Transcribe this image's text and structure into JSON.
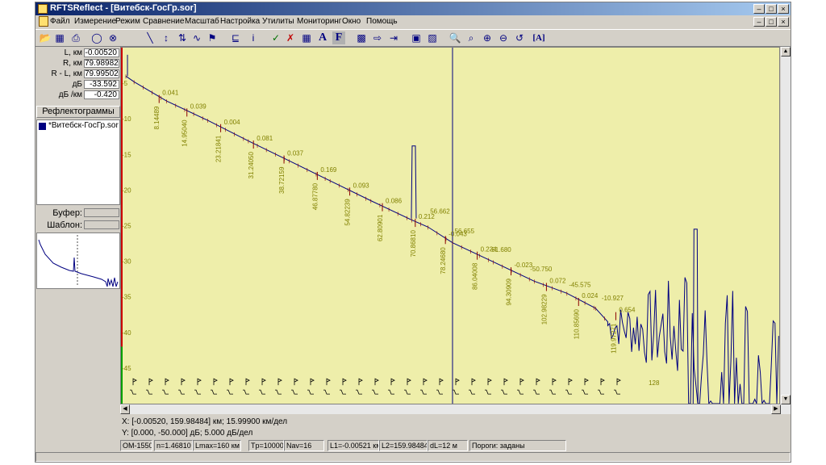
{
  "window": {
    "title": "RFTSReflect - [Витебск-ГосГр.sor]"
  },
  "menu": [
    "Файл",
    "Измерение",
    "Режим",
    "Сравнение",
    "Масштаб",
    "Настройка",
    "Утилиты",
    "Мониторинг",
    "Окно",
    "Помощь"
  ],
  "toolbar_icons": [
    "open-icon",
    "save-icon",
    "print-icon",
    "circle-icon",
    "circle-x-icon",
    "trace-icon",
    "trace-marks-icon",
    "split-marks-icon",
    "wave-icon",
    "flag-icon",
    "event-table-icon",
    "info-icon",
    "check-icon",
    "delete-marker-icon",
    "grid-icon",
    "font-a-icon",
    "font-f-icon",
    "chat-icon",
    "export-icon",
    "import-icon",
    "marker-add-icon",
    "marker-move-icon",
    "zoom-region-icon",
    "zoom-fit-icon",
    "zoom-in-icon",
    "zoom-out-icon",
    "refresh-icon",
    "text-a-icon"
  ],
  "params": [
    {
      "label": "L, км",
      "value": "-0.00520"
    },
    {
      "label": "R, км",
      "value": "79.98982"
    },
    {
      "label": "R - L, км",
      "value": "79.99502"
    },
    {
      "label": "дБ",
      "value": "-33.592"
    },
    {
      "label": "дБ /км",
      "value": "-0.420"
    }
  ],
  "reflectograms": {
    "title": "Рефлектограммы",
    "files": [
      "*Витебск-ГосГр.sor"
    ]
  },
  "buffer": {
    "label": "Буфер:",
    "value": ""
  },
  "template": {
    "label": "Шаблон:",
    "value": ""
  },
  "info": {
    "x_line": "X: [-0.00520, 159.98484] км; 15.99900 км/дел",
    "y_line": "Y: [0.000, -50.000] дБ; 5.000 дБ/дел"
  },
  "status": [
    "OM-1550",
    "n=1.46810",
    "Lmax=160 км",
    "Tp=10000",
    "Nav=16",
    "L1=-0.00521 км",
    "L2=159.98484",
    "dL=12 м",
    "Пороги: заданы"
  ],
  "colors": {
    "plot_bg": "#eeeeaa",
    "trace": "#000080",
    "event_mark": "#8b0000",
    "label": "#808000",
    "cursor": "#000080",
    "left_marker": "#cc0000"
  },
  "chart_data": {
    "type": "line",
    "x_range_km": [
      -0.0052,
      159.98484
    ],
    "ylim": [
      -50,
      0
    ],
    "y_ticks": [
      -5,
      -10,
      -15,
      -20,
      -25,
      -30,
      -35,
      -40,
      -45
    ],
    "trace": {
      "x": [
        0,
        2,
        10,
        20,
        30,
        40,
        50,
        60,
        70,
        74,
        80,
        90,
        100,
        108,
        115,
        118
      ],
      "y": [
        -4.0,
        -4.8,
        -7.5,
        -10.2,
        -13.1,
        -15.9,
        -18.7,
        -21.5,
        -24.2,
        -25.2,
        -27.4,
        -30.1,
        -32.8,
        -34.5,
        -36.6,
        -38.5
      ]
    },
    "noise_from_km": 118,
    "reflective_peaks": [
      {
        "x": 70.5,
        "y": -13.8
      },
      {
        "x": 139.5,
        "y": -25.5
      }
    ],
    "cursor_km": 79.98982,
    "events": [
      {
        "dist": "8.14489",
        "x": 8.14489,
        "loss": "0.041",
        "y": -7.1
      },
      {
        "dist": "14.95040",
        "x": 14.9504,
        "loss": "0.039",
        "y": -9.0
      },
      {
        "dist": "23.21841",
        "x": 23.21841,
        "loss": "0.004",
        "y": -11.2
      },
      {
        "dist": "31.24050",
        "x": 31.2405,
        "loss": "0.081",
        "y": -13.5
      },
      {
        "dist": "38.72159",
        "x": 38.72159,
        "loss": "0.037",
        "y": -15.6
      },
      {
        "dist": "46.87780",
        "x": 46.8778,
        "loss": "0.169",
        "y": -17.9
      },
      {
        "dist": "54.82239",
        "x": 54.82239,
        "loss": "0.093",
        "y": -20.1
      },
      {
        "dist": "62.80901",
        "x": 62.80901,
        "loss": "0.086",
        "y": -22.3
      },
      {
        "dist": "70.86810",
        "x": 70.8681,
        "loss": "0.212",
        "y": -24.5
      },
      {
        "dist": "78.24680",
        "x": 78.2468,
        "loss": "-0.043",
        "y": -26.9
      },
      {
        "dist": "86.04008",
        "x": 86.04008,
        "loss": "0.234",
        "y": -29.1
      },
      {
        "dist": "94.30909",
        "x": 94.30909,
        "loss": "-0.023",
        "y": -31.3
      },
      {
        "dist": "102.98229",
        "x": 102.98229,
        "loss": "0.072",
        "y": -33.5
      },
      {
        "dist": "110.85690",
        "x": 110.8569,
        "loss": "0.024",
        "y": -35.6
      },
      {
        "dist": "119.97271",
        "x": 119.97271,
        "loss": "0.654",
        "y": -37.6
      }
    ],
    "reflectances": [
      {
        "text": "56.662",
        "x": 74.5,
        "y": -23.3
      },
      {
        "text": "56.655",
        "x": 80.5,
        "y": -26.1
      },
      {
        "text": "-51.680",
        "x": 89.0,
        "y": -28.7
      },
      {
        "text": "-50.750",
        "x": 99.0,
        "y": -31.4
      },
      {
        "text": "-45.575",
        "x": 108.5,
        "y": -33.6
      },
      {
        "text": "-10.927",
        "x": 116.5,
        "y": -35.5
      }
    ],
    "end_marker": {
      "text": "128",
      "x": 128,
      "y": -47.4
    }
  }
}
